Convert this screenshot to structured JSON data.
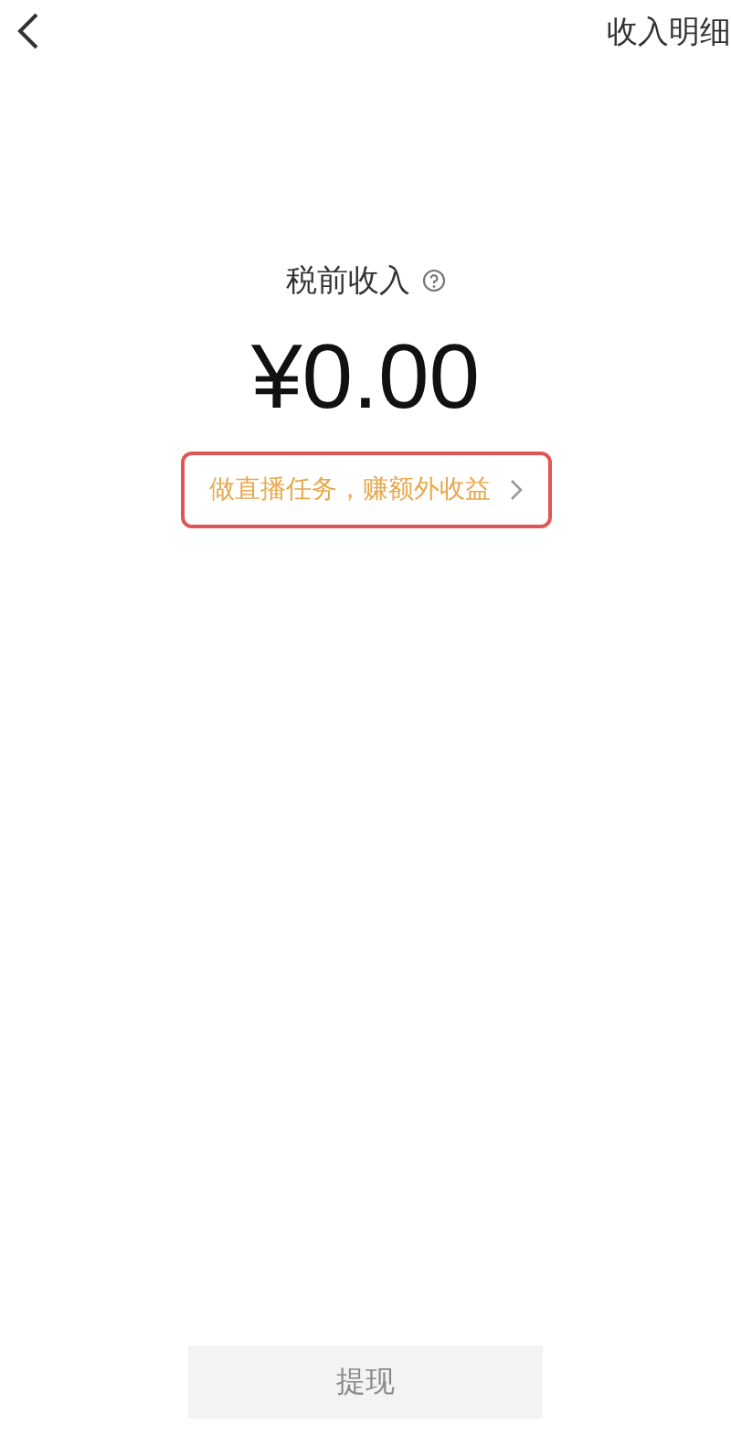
{
  "header": {
    "action": "收入明细"
  },
  "income": {
    "label": "税前收入",
    "amount": "¥0.00",
    "promo": {
      "text": "做直播任务，赚额外收益",
      "highlighted": true
    }
  },
  "withdraw_button": {
    "label": "提现",
    "disabled": true
  }
}
